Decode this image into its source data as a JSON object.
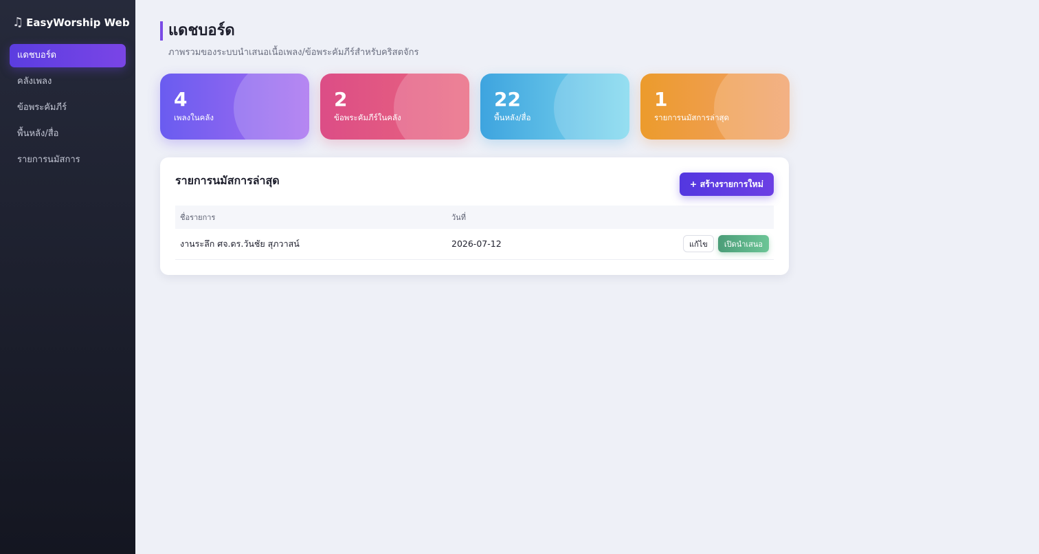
{
  "app": {
    "brand_icon": "♫",
    "brand": "EasyWorship Web"
  },
  "sidebar": {
    "items": [
      {
        "label": "แดชบอร์ด",
        "active": true
      },
      {
        "label": "คลังเพลง",
        "active": false
      },
      {
        "label": "ข้อพระคัมภีร์",
        "active": false
      },
      {
        "label": "พื้นหลัง/สื่อ",
        "active": false
      },
      {
        "label": "รายการนมัสการ",
        "active": false
      }
    ]
  },
  "page": {
    "title": "แดชบอร์ด",
    "subtitle": "ภาพรวมของระบบนำเสนอเนื้อเพลง/ข้อพระคัมภีร์สำหรับคริสตจักร"
  },
  "stats": [
    {
      "value": "4",
      "label": "เพลงในคลัง",
      "color": "#6a5cf0"
    },
    {
      "value": "2",
      "label": "ข้อพระคัมภีร์ในคลัง",
      "color": "#dc4d86"
    },
    {
      "value": "22",
      "label": "พื้นหลัง/สื่อ",
      "color": "#3ea4df"
    },
    {
      "value": "1",
      "label": "รายการนมัสการล่าสุด",
      "color": "#ec9b2c"
    }
  ],
  "recent": {
    "title": "รายการนมัสการล่าสุด",
    "new_button": "+ สร้างรายการใหม่",
    "columns": [
      "ชื่อรายการ",
      "วันที่"
    ],
    "rows": [
      {
        "name": "งานระลึก ศจ.ดร.วันชัย สุภวาสน์",
        "date": "2026-07-12",
        "edit": "แก้ไข",
        "present": "เปิดนำเสนอ"
      }
    ]
  },
  "colors": {
    "accent": "#6b3fe4",
    "success": "#4b9d78"
  }
}
